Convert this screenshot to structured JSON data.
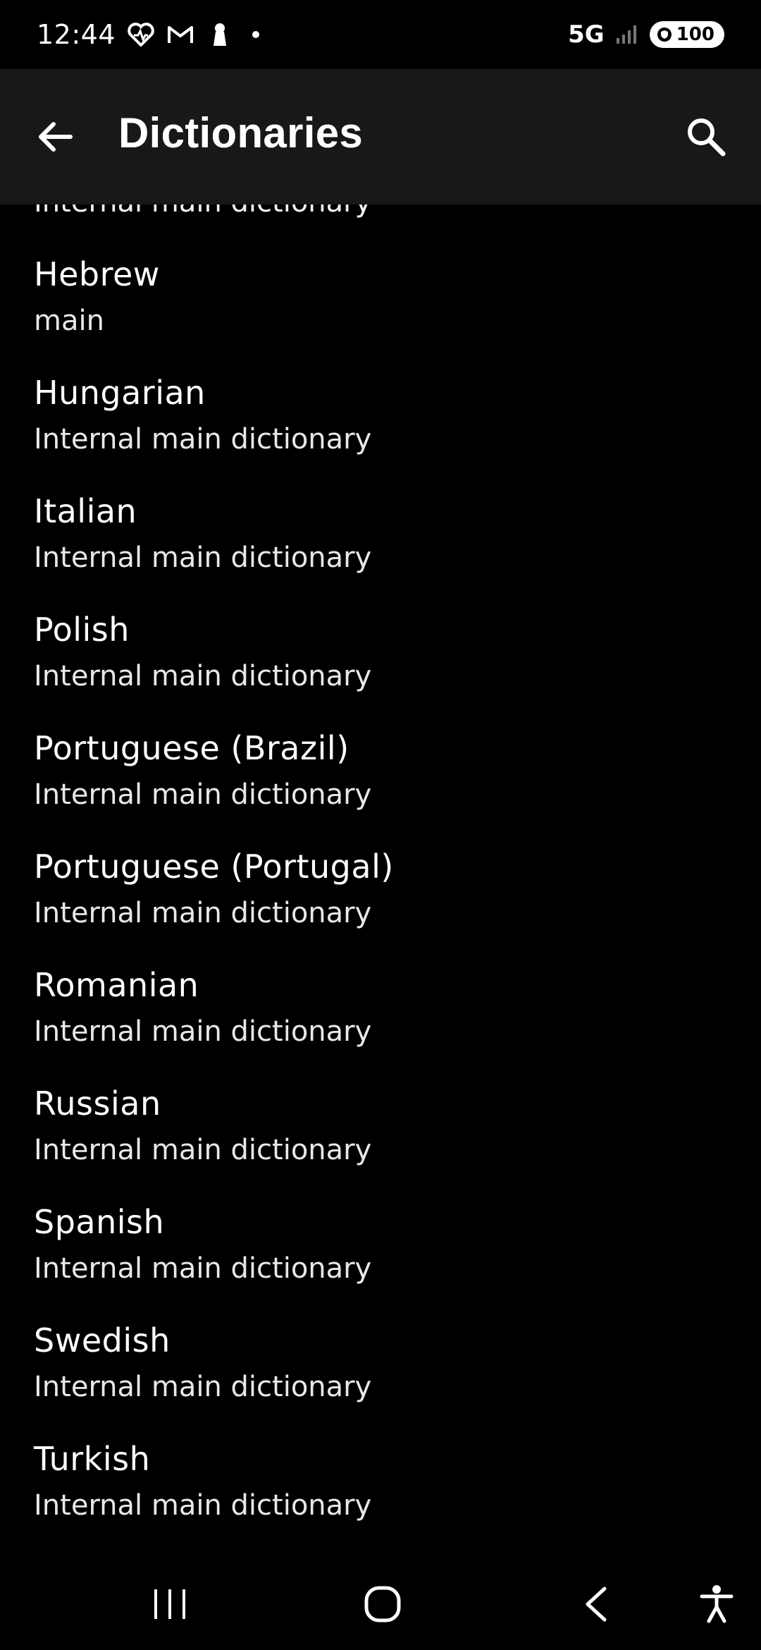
{
  "status": {
    "time": "12:44",
    "network": "5G",
    "battery": "100"
  },
  "app_bar": {
    "title": "Dictionaries"
  },
  "list": {
    "partial_subtitle": "Internal main dictionary",
    "items": [
      {
        "title": "Hebrew",
        "subtitle": "main"
      },
      {
        "title": "Hungarian",
        "subtitle": "Internal main dictionary"
      },
      {
        "title": "Italian",
        "subtitle": "Internal main dictionary"
      },
      {
        "title": "Polish",
        "subtitle": "Internal main dictionary"
      },
      {
        "title": "Portuguese (Brazil)",
        "subtitle": "Internal main dictionary"
      },
      {
        "title": "Portuguese (Portugal)",
        "subtitle": "Internal main dictionary"
      },
      {
        "title": "Romanian",
        "subtitle": "Internal main dictionary"
      },
      {
        "title": "Russian",
        "subtitle": "Internal main dictionary"
      },
      {
        "title": "Spanish",
        "subtitle": "Internal main dictionary"
      },
      {
        "title": "Swedish",
        "subtitle": "Internal main dictionary"
      },
      {
        "title": "Turkish",
        "subtitle": "Internal main dictionary"
      }
    ]
  },
  "icons": {
    "back": "arrow-left-icon",
    "search": "search-icon",
    "recents": "recents-icon",
    "home": "home-icon",
    "nav_back": "nav-back-icon",
    "accessibility": "accessibility-icon"
  }
}
